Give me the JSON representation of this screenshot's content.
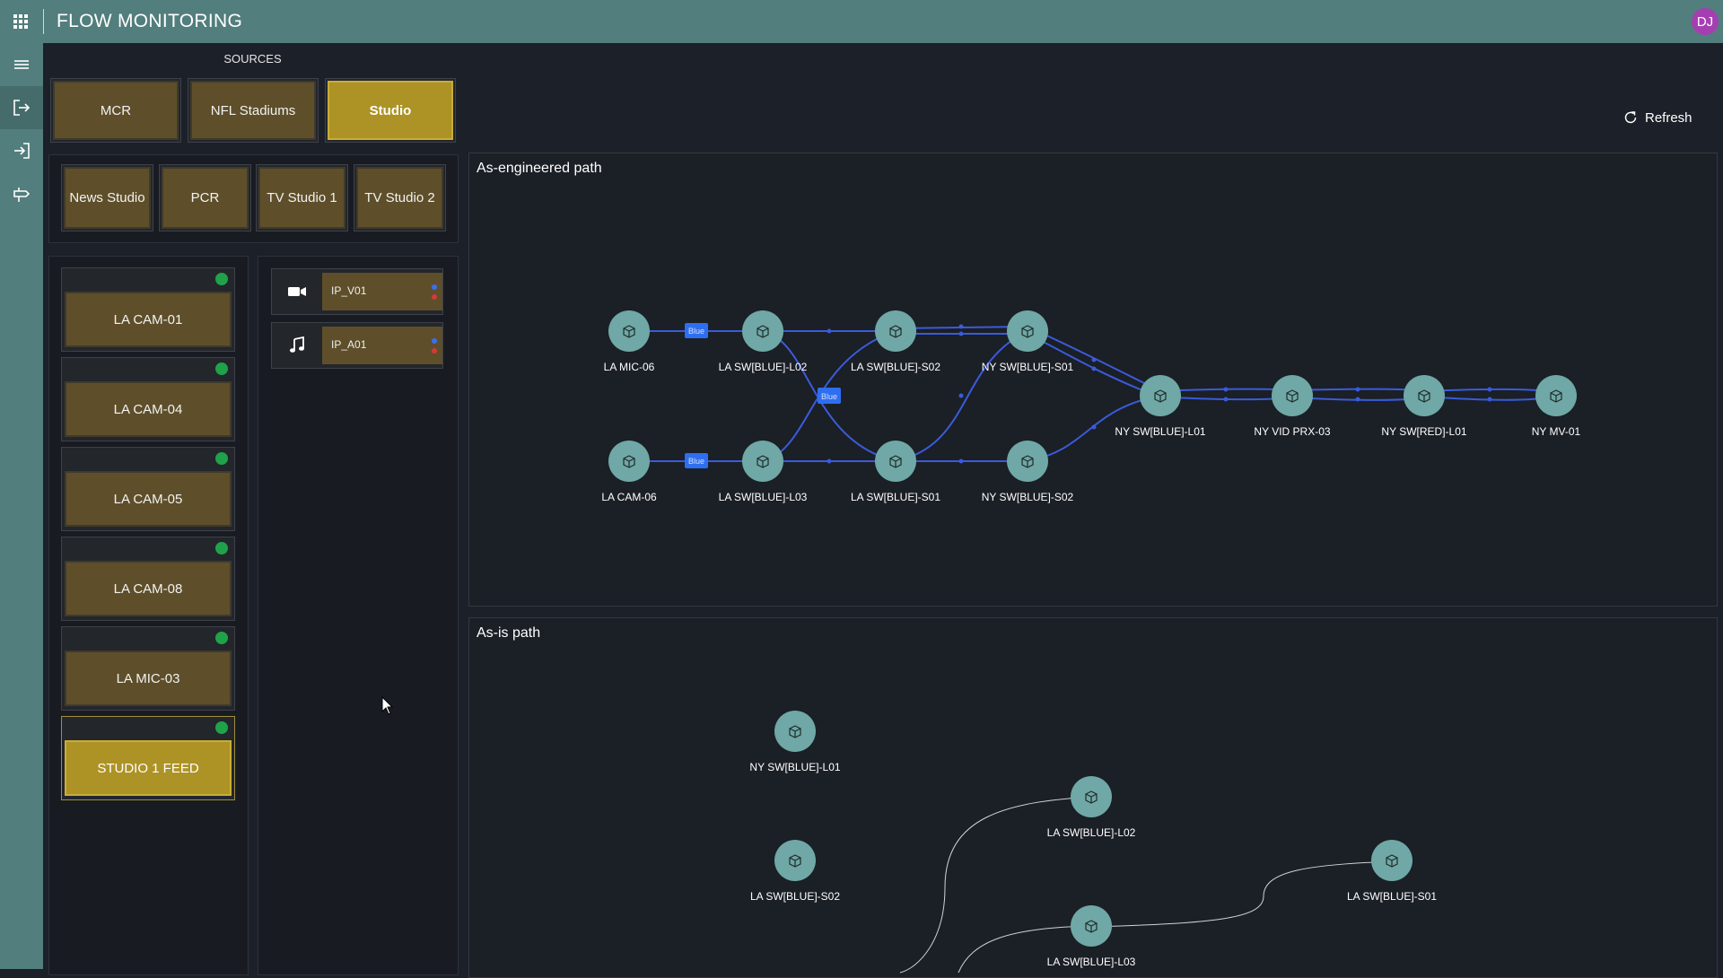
{
  "app": {
    "title": "FLOW MONITORING",
    "user_initials": "DJ"
  },
  "sources": {
    "heading": "SOURCES",
    "categories": [
      "MCR",
      "NFL Stadiums",
      "Studio"
    ],
    "selected_category": "Studio",
    "subcategories": [
      "News Studio",
      "PCR",
      "TV Studio 1",
      "TV Studio 2"
    ],
    "devices": [
      {
        "label": "LA CAM-01",
        "status": "online"
      },
      {
        "label": "LA CAM-04",
        "status": "online"
      },
      {
        "label": "LA CAM-05",
        "status": "online"
      },
      {
        "label": "LA CAM-08",
        "status": "online"
      },
      {
        "label": "LA MIC-03",
        "status": "online"
      },
      {
        "label": "STUDIO 1 FEED",
        "status": "online",
        "selected": true
      }
    ],
    "flows": [
      {
        "label": "IP_V01",
        "icon": "video-camera-icon"
      },
      {
        "label": "IP_A01",
        "icon": "music-note-icon"
      }
    ]
  },
  "toolbar": {
    "refresh_label": "Refresh"
  },
  "engineered": {
    "title": "As-engineered path",
    "nodes": [
      "LA MIC-06",
      "LA SW[BLUE]-L02",
      "LA SW[BLUE]-S02",
      "NY SW[BLUE]-S01",
      "LA CAM-06",
      "LA SW[BLUE]-L03",
      "LA SW[BLUE]-S01",
      "NY SW[BLUE]-S02",
      "NY SW[BLUE]-L01",
      "NY VID PRX-03",
      "NY SW[RED]-L01",
      "NY MV-01"
    ],
    "badges": [
      "Blue",
      "Blue",
      "Blue"
    ]
  },
  "asis": {
    "title": "As-is path",
    "nodes": [
      "NY SW[BLUE]-L01",
      "LA SW[BLUE]-L02",
      "LA SW[BLUE]-S02",
      "LA SW[BLUE]-S01",
      "LA SW[BLUE]-L03"
    ]
  },
  "colors": {
    "accent": "#ad9325",
    "node": "#6fa8a6",
    "link": "#3b5bd6",
    "status_ok": "#1fa24a",
    "topbar": "#527e7d"
  }
}
